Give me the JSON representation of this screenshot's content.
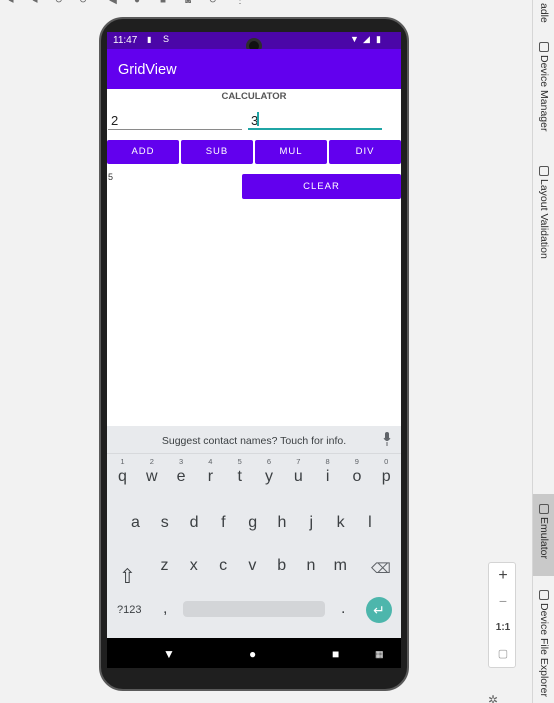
{
  "statusbar": {
    "time": "11:47"
  },
  "app": {
    "title": "GridView"
  },
  "calculator": {
    "title": "CALCULATOR",
    "field1_value": "2",
    "field2_value": "3",
    "buttons": [
      "ADD",
      "SUB",
      "MUL",
      "DIV"
    ],
    "result": "5",
    "clear_label": "CLEAR"
  },
  "keyboard": {
    "suggestion": "Suggest contact names? Touch for info.",
    "row1": [
      "q",
      "w",
      "e",
      "r",
      "t",
      "y",
      "u",
      "i",
      "o",
      "p"
    ],
    "row1_hints": [
      "1",
      "2",
      "3",
      "4",
      "5",
      "6",
      "7",
      "8",
      "9",
      "0"
    ],
    "row2": [
      "a",
      "s",
      "d",
      "f",
      "g",
      "h",
      "j",
      "k",
      "l"
    ],
    "row3": [
      "z",
      "x",
      "c",
      "v",
      "b",
      "n",
      "m"
    ],
    "symbols_label": "?123",
    "comma": ",",
    "period": "."
  },
  "sidebar": {
    "tabs": [
      "adle",
      "Device Manager",
      "Layout Validation",
      "Emulator",
      "Device File Explorer"
    ]
  },
  "zoom": {
    "plus": "+",
    "minus": "−",
    "one_to_one": "1:1"
  },
  "colors": {
    "primary": "#6200EE",
    "primary_dark": "#4B06A8",
    "accent": "#1FA5A5",
    "enter": "#4DB6AC"
  }
}
